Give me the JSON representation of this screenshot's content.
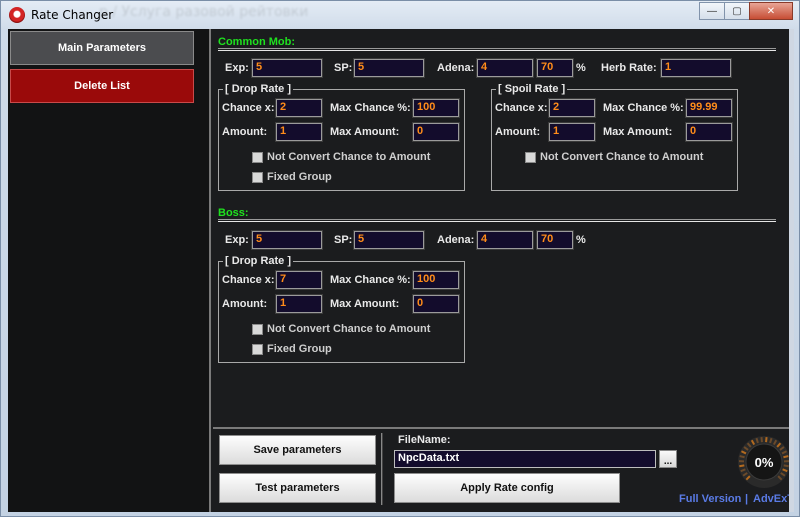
{
  "window": {
    "title": "Rate Changer",
    "ghost_title": "р / Услуга разовой рейтовки",
    "controls": {
      "minimize": "—",
      "maximize": "▢",
      "close": "✕"
    }
  },
  "sidebar": {
    "main_parameters": "Main Parameters",
    "delete_list": "Delete List"
  },
  "common_mob": {
    "title": "Common Mob:",
    "exp_label": "Exp:",
    "exp": "5",
    "sp_label": "SP:",
    "sp": "5",
    "adena_label": "Adena:",
    "adena": "4",
    "adena_pct": "70",
    "pct_sign": "%",
    "herb_label": "Herb Rate:",
    "herb": "1",
    "drop": {
      "title": "[ Drop Rate ]",
      "chance_label": "Chance x:",
      "chance": "2",
      "max_chance_label": "Max Chance %:",
      "max_chance": "100",
      "amount_label": "Amount:",
      "amount": "1",
      "max_amount_label": "Max Amount:",
      "max_amount": "0",
      "not_convert": "Not Convert Chance to Amount",
      "fixed_group": "Fixed Group"
    },
    "spoil": {
      "title": "[ Spoil Rate ]",
      "chance_label": "Chance x:",
      "chance": "2",
      "max_chance_label": "Max Chance %:",
      "max_chance": "99.99",
      "amount_label": "Amount:",
      "amount": "1",
      "max_amount_label": "Max Amount:",
      "max_amount": "0",
      "not_convert": "Not Convert Chance to Amount"
    }
  },
  "boss": {
    "title": "Boss:",
    "exp_label": "Exp:",
    "exp": "5",
    "sp_label": "SP:",
    "sp": "5",
    "adena_label": "Adena:",
    "adena": "4",
    "adena_pct": "70",
    "pct_sign": "%",
    "drop": {
      "title": "[ Drop Rate ]",
      "chance_label": "Chance x:",
      "chance": "7",
      "max_chance_label": "Max Chance %:",
      "max_chance": "100",
      "amount_label": "Amount:",
      "amount": "1",
      "max_amount_label": "Max Amount:",
      "max_amount": "0",
      "not_convert": "Not Convert Chance to Amount",
      "fixed_group": "Fixed Group"
    }
  },
  "bottom": {
    "save": "Save parameters",
    "test": "Test parameters",
    "filename_label": "FileName:",
    "filename": "NpcData.txt",
    "browse": "...",
    "apply": "Apply Rate config",
    "progress_text": "0%",
    "progress": 0,
    "full_version": "Full Version",
    "separator": "|",
    "author": "AdvExT"
  },
  "colors": {
    "accent_green": "#1fe11f",
    "value_orange": "#ff8c1a",
    "delete_red": "#9a0a0a",
    "link_blue": "#5a7be6"
  }
}
